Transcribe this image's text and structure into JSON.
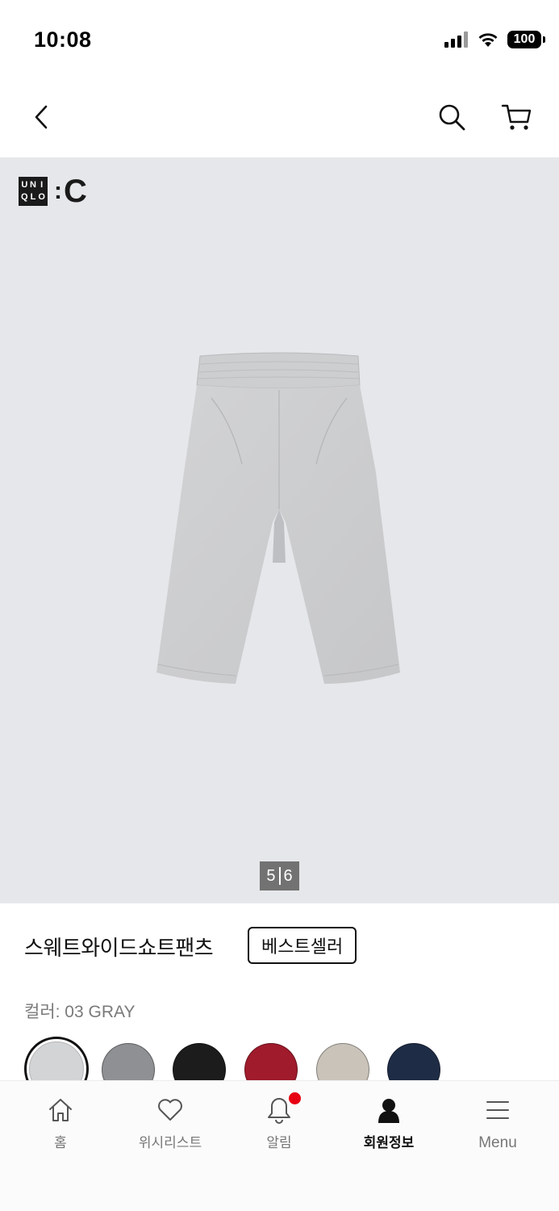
{
  "status_bar": {
    "time": "10:08",
    "battery": "100"
  },
  "nav": {
    "back_icon": "chevron-left-icon",
    "search_icon": "search-icon",
    "cart_icon": "cart-icon"
  },
  "gallery": {
    "brand_letters": [
      "U",
      "N",
      "I",
      "Q",
      "L",
      "O"
    ],
    "brand_suffix": "C",
    "page_current": "5",
    "page_total": "6",
    "background": "#e6e7ea"
  },
  "product": {
    "name": "스웨트와이드쇼트팬츠",
    "badge": "베스트셀러",
    "color_label": "컬러: 03 GRAY",
    "swatches": [
      {
        "color": "#d3d4d6",
        "selected": true
      },
      {
        "color": "#8f9093",
        "selected": false
      },
      {
        "color": "#1c1c1c",
        "selected": false
      },
      {
        "color": "#a01b2c",
        "selected": false
      },
      {
        "color": "#c9c3ba",
        "selected": false
      },
      {
        "color": "#1f2c46",
        "selected": false
      }
    ]
  },
  "tab_bar": {
    "items": [
      {
        "label": "홈",
        "icon": "home-icon"
      },
      {
        "label": "위시리스트",
        "icon": "heart-icon"
      },
      {
        "label": "알림",
        "icon": "bell-icon",
        "has_notification": true
      },
      {
        "label": "회원정보",
        "icon": "user-icon",
        "active": true
      },
      {
        "label": "Menu",
        "icon": "menu-icon"
      }
    ],
    "notification_color": "#e60012"
  }
}
